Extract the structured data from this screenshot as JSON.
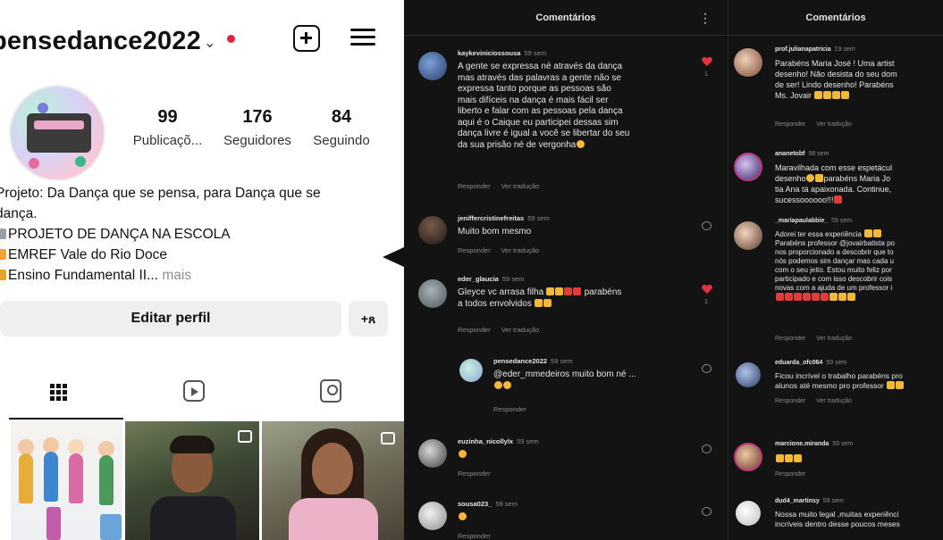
{
  "profile": {
    "username": "pensedance2022",
    "stats": [
      {
        "value": "99",
        "label": "Publicaçõ..."
      },
      {
        "value": "176",
        "label": "Seguidores"
      },
      {
        "value": "84",
        "label": "Seguindo"
      }
    ],
    "bio_line1": "Projeto: Da Dança que se pensa, para Dança que se",
    "bio_line2": "dança.",
    "bio_line3": "PROJETO DE DANÇA NA ESCOLA",
    "bio_line4": "EMREF Vale do Rio Doce",
    "bio_line5": "Ensino Fundamental II...",
    "bio_more": "mais",
    "edit_profile_label": "Editar perfil",
    "add_user_label": "+ጸ",
    "bullet_colors": [
      "#9aa0a6",
      "#f2a23a",
      "#e6a32b"
    ]
  },
  "comments_panel_1": {
    "title": "Comentários",
    "comments": [
      {
        "username": "kaykeviniciossousa",
        "time": "59 sem",
        "lines": [
          "A gente se expressa né através da dança",
          "mas através das palavras a gente não se",
          "expressa tanto porque as pessoas são",
          "mais difíceis na dança é mais fácil ser",
          "liberto e falar com as pessoas pela dança",
          "aqui é o Caique eu participei dessas sim",
          "dança livre é igual a você se libertar do seu",
          "da sua prisão né de vergonha"
        ],
        "reply": "Responder",
        "translate": "Ver tradução",
        "likes": "1"
      },
      {
        "username": "jeniffercristinefreitas",
        "time": "59 sem",
        "lines": [
          "Muito bom mesmo"
        ],
        "reply": "Responder",
        "translate": "Ver tradução"
      },
      {
        "username": "eder_glaucia",
        "time": "59 sem",
        "lines": [
          "Gleyce vc arrasa filha",
          "parabéns",
          "a todos envolvidos"
        ],
        "reply": "Responder",
        "translate": "Ver tradução",
        "likes": "1"
      },
      {
        "username": "pensedance2022",
        "time": "59 sem",
        "lines": [
          "@eder_mmedeiros muito bom né ..."
        ],
        "reply": "Responder"
      },
      {
        "username": "euzinha_nicollylx",
        "time": "59 sem",
        "reply": "Responder"
      },
      {
        "username": "sousa023_",
        "time": "59 sem",
        "reply": "Responder"
      }
    ]
  },
  "comments_panel_2": {
    "title": "Comentários",
    "comments": [
      {
        "username": "prof.julianapatricia",
        "time": "19 sem",
        "lines": [
          "Parabéns Maria José ! Uma artist",
          "desenho! Não desista do seu dom",
          "de ser! Lindo desenho! Parabéns",
          "Ms. Jovair"
        ],
        "reply": "Responder",
        "translate": "Ver tradução"
      },
      {
        "username": "ananetobf",
        "time": "58 sem",
        "lines": [
          "Maravilhada com esse espetácul",
          "desenho",
          "parabéns Maria Jo",
          "tia Ana tá apaixonada. Continue,",
          "sucessoooooo!!!"
        ],
        "reply": "Responder",
        "translate": "Ver tradução"
      },
      {
        "username": "_mariapaulabbie_",
        "time": "59 sem",
        "lines": [
          "Adorei ter essa experiência",
          "Parabéns professor @jovairbatista po",
          "nos proporcionado a descobrir que to",
          "nós podemos sim dançar mas cada u",
          "com o seu jeito. Estou muito feliz por",
          "participado e com isso descobrir cois",
          "novas com a ajuda de um professor i"
        ],
        "reply": "Responder",
        "translate": "Ver tradução"
      },
      {
        "username": "eduarda_ofc064",
        "time": "59 sem",
        "lines": [
          "Ficou incrível o trabalho parabéns pro",
          "alunos até mesmo pro professor"
        ],
        "reply": "Responder",
        "translate": "Ver tradução"
      },
      {
        "username": "marcione.miranda",
        "time": "59 sem",
        "reply": "Responder"
      },
      {
        "username": "dud4_martinsy",
        "time": "59 sem",
        "lines": [
          "Nossa muito legal ,muitas experiênci",
          "incríveis dentro desse poucos meses"
        ]
      }
    ]
  },
  "colors": {
    "dark_bg": "#131313",
    "like_red": "#e8313f",
    "emoji_yellow": "#f6b73c",
    "live_dot": "#e0243b"
  },
  "icons": [
    "chevron-down-icon",
    "plus-square-icon",
    "menu-icon",
    "add-user-icon",
    "grid-icon",
    "reels-icon",
    "tagged-icon",
    "heart-icon",
    "kebab-icon"
  ]
}
